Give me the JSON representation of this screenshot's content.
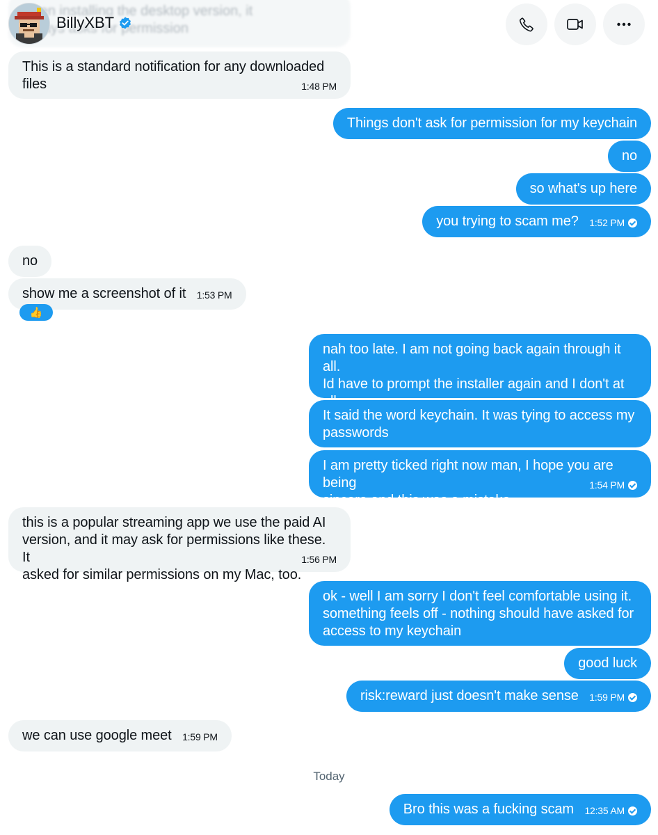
{
  "header": {
    "contact_name": "BillyXBT",
    "faded_message_line1": "when installing the desktop version, it",
    "faded_message_line2": "always asks for permission"
  },
  "messages": [
    {
      "id": "m1",
      "dir": "in",
      "text": "This is a standard notification for any downloaded\nfiles",
      "time": "1:48 PM"
    },
    {
      "id": "m2",
      "dir": "out",
      "text": "Things don't ask for permission for my keychain"
    },
    {
      "id": "m3",
      "dir": "out",
      "text": "no"
    },
    {
      "id": "m4",
      "dir": "out",
      "text": "so what's up here"
    },
    {
      "id": "m5",
      "dir": "out",
      "text": "you trying to scam me?",
      "time": "1:52 PM"
    },
    {
      "id": "m6",
      "dir": "in",
      "text": "no"
    },
    {
      "id": "m7",
      "dir": "in",
      "text": "show me a screenshot of it",
      "time": "1:53 PM",
      "reaction": "👍"
    },
    {
      "id": "m8",
      "dir": "out",
      "text": "nah too late. I am not going back again through it all.\nId have to prompt the installer again and I don't at all\nfeel comfortable."
    },
    {
      "id": "m9",
      "dir": "out",
      "text": "It said the word keychain. It was tying to access my\npasswords"
    },
    {
      "id": "m10",
      "dir": "out",
      "text": "I am pretty ticked right now man, I hope you are being\nsincere and this was a mistake",
      "time": "1:54 PM"
    },
    {
      "id": "m11",
      "dir": "in",
      "text": "this is a popular streaming app we use the paid AI\nversion, and it may ask for permissions like these. It\nasked for similar permissions on my Mac, too.",
      "time": "1:56 PM"
    },
    {
      "id": "m12",
      "dir": "out",
      "text": "ok - well I am sorry I don't feel comfortable using it.\nsomething feels off - nothing should have asked for\naccess to my keychain"
    },
    {
      "id": "m13",
      "dir": "out",
      "text": "good luck"
    },
    {
      "id": "m14",
      "dir": "out",
      "text": "risk:reward just doesn't make sense",
      "time": "1:59 PM"
    },
    {
      "id": "m15",
      "dir": "in",
      "text": "we can use google meet",
      "time": "1:59 PM"
    },
    {
      "id": "m16",
      "dir": "out",
      "text": "Bro this was a fucking scam",
      "time": "12:35 AM"
    }
  ],
  "day_separator": "Today",
  "icons": {
    "call": "phone-icon",
    "video": "video-icon",
    "more": "more-icon",
    "verified": "verified-badge-icon",
    "read_receipt": "read-check-icon"
  },
  "colors": {
    "outgoing_bubble": "#1d9bf0",
    "incoming_bubble": "#eff3f4",
    "verified": "#1d9bf0"
  }
}
